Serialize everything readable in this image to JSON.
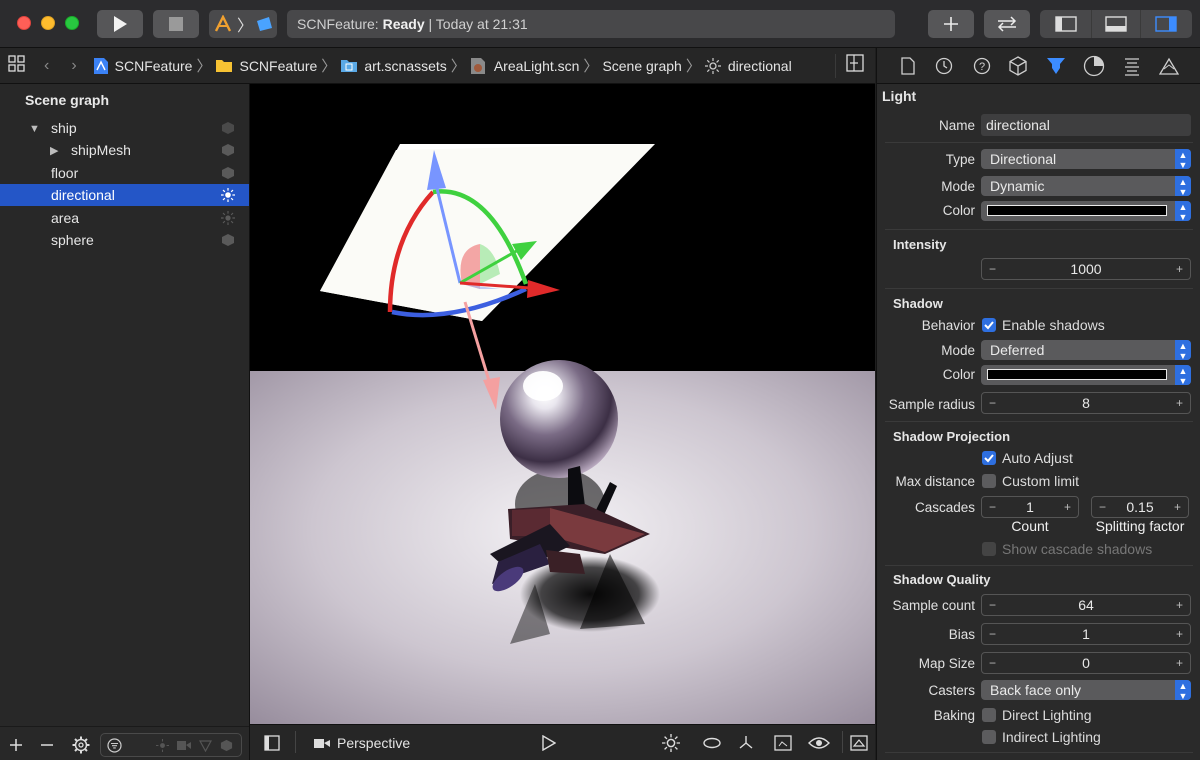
{
  "titlebar": {
    "scheme_status_app": "SCNFeature:",
    "scheme_status_state": "Ready",
    "scheme_status_time": "| Today at 21:31"
  },
  "breadcrumb": [
    "SCNFeature",
    "SCNFeature",
    "art.scnassets",
    "AreaLight.scn",
    "Scene graph",
    "directional"
  ],
  "sidebar": {
    "title": "Scene graph",
    "items": [
      {
        "label": "ship",
        "indent": 0,
        "disclosure": "open",
        "icon": "node-cube-icon"
      },
      {
        "label": "shipMesh",
        "indent": 1,
        "disclosure": "closed",
        "icon": "node-cube-icon"
      },
      {
        "label": "floor",
        "indent": 0,
        "disclosure": "none",
        "icon": "node-cube-icon"
      },
      {
        "label": "directional",
        "indent": 0,
        "disclosure": "none",
        "icon": "light-sun-icon",
        "selected": true
      },
      {
        "label": "area",
        "indent": 0,
        "disclosure": "none",
        "icon": "light-sun-icon"
      },
      {
        "label": "sphere",
        "indent": 0,
        "disclosure": "none",
        "icon": "node-cube-icon"
      }
    ]
  },
  "viewport": {
    "camera_label": "Perspective"
  },
  "inspector": {
    "light_title": "Light",
    "name_label": "Name",
    "name_value": "directional",
    "type_label": "Type",
    "type_value": "Directional",
    "mode_label": "Mode",
    "mode_value": "Dynamic",
    "color_label": "Color",
    "intensity_title": "Intensity",
    "intensity_value": "1000",
    "shadow_title": "Shadow",
    "behavior_label": "Behavior",
    "enable_shadows_label": "Enable shadows",
    "shadow_mode_label": "Mode",
    "shadow_mode_value": "Deferred",
    "shadow_color_label": "Color",
    "sample_radius_label": "Sample radius",
    "sample_radius_value": "8",
    "projection_title": "Shadow Projection",
    "auto_adjust_label": "Auto Adjust",
    "max_distance_label": "Max distance",
    "custom_limit_label": "Custom limit",
    "cascades_label": "Cascades",
    "cascades_count_value": "1",
    "splitting_factor_value": "0.15",
    "count_caption": "Count",
    "splitting_caption": "Splitting factor",
    "show_cascade_label": "Show cascade shadows",
    "quality_title": "Shadow Quality",
    "sample_count_label": "Sample count",
    "sample_count_value": "64",
    "bias_label": "Bias",
    "bias_value": "1",
    "map_size_label": "Map Size",
    "map_size_value": "0",
    "casters_label": "Casters",
    "casters_value": "Back face only",
    "baking_label": "Baking",
    "direct_lighting_label": "Direct Lighting",
    "indirect_lighting_label": "Indirect Lighting"
  },
  "colors": {
    "selection": "#2456c7",
    "accent": "#2e6fe0"
  }
}
